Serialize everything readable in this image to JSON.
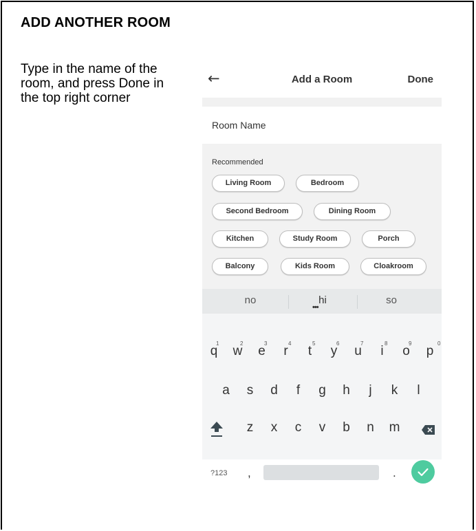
{
  "heading": "ADD ANOTHER ROOM",
  "instructions": "Type in the name of the room, and press Done in the top right corner",
  "phone": {
    "header": {
      "title": "Add a Room",
      "done_label": "Done"
    },
    "room_name_placeholder": "Room Name",
    "recommended_label": "Recommended",
    "chips": [
      "Living Room",
      "Bedroom",
      "Second Bedroom",
      "Dining Room",
      "Kitchen",
      "Study Room",
      "Porch",
      "Balcony",
      "Kids Room",
      "Cloakroom"
    ],
    "suggestions": [
      "no",
      "hi",
      "so"
    ],
    "keyboard": {
      "row1": [
        "q",
        "w",
        "e",
        "r",
        "t",
        "y",
        "u",
        "i",
        "o",
        "p"
      ],
      "row1_numbers": [
        "1",
        "2",
        "3",
        "4",
        "5",
        "6",
        "7",
        "8",
        "9",
        "0"
      ],
      "row2": [
        "a",
        "s",
        "d",
        "f",
        "g",
        "h",
        "j",
        "k",
        "l"
      ],
      "row3": [
        "z",
        "x",
        "c",
        "v",
        "b",
        "n",
        "m"
      ],
      "symbols_label": "?123",
      "comma": ",",
      "period": "."
    },
    "accent_color": "#4ecb9f"
  }
}
